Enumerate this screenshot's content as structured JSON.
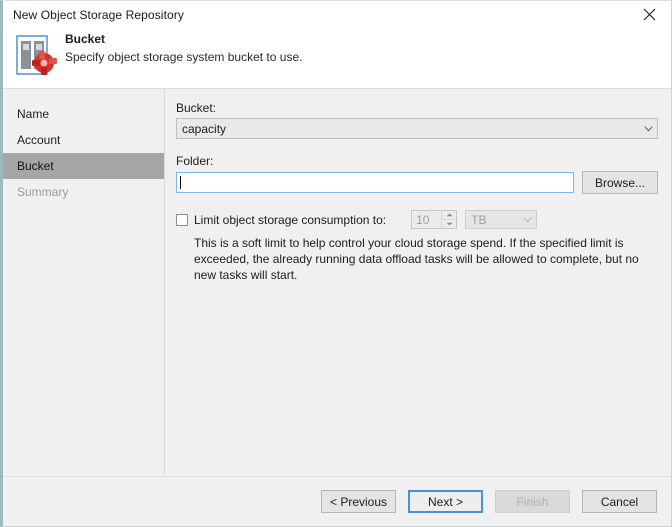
{
  "window": {
    "title": "New Object Storage Repository",
    "close_icon": "close-icon"
  },
  "header": {
    "title": "Bucket",
    "subtitle": "Specify object storage system bucket to use.",
    "icon": "object-storage-repository-icon"
  },
  "sidebar": {
    "items": [
      {
        "label": "Name",
        "state": "normal"
      },
      {
        "label": "Account",
        "state": "normal"
      },
      {
        "label": "Bucket",
        "state": "selected"
      },
      {
        "label": "Summary",
        "state": "disabled"
      }
    ]
  },
  "main": {
    "bucket": {
      "label": "Bucket:",
      "value": "capacity",
      "arrow_icon": "chevron-down-icon"
    },
    "folder": {
      "label": "Folder:",
      "value": "",
      "browse_label": "Browse..."
    },
    "limit": {
      "checkbox_label": "Limit object storage consumption to:",
      "checked": false,
      "amount": "10",
      "unit": "TB",
      "unit_arrow_icon": "chevron-down-icon",
      "spinner_up_icon": "spinner-up-icon",
      "spinner_down_icon": "spinner-down-icon",
      "hint": "This is a soft limit to help control your cloud storage spend. If the specified limit is exceeded, the already running data offload tasks will be allowed to complete, but no new tasks will start."
    }
  },
  "footer": {
    "previous_label": "< Previous",
    "next_label": "Next >",
    "finish_label": "Finish",
    "cancel_label": "Cancel"
  },
  "colors": {
    "accent_focus": "#7eb4ea",
    "default_button_border": "#4a90d9",
    "selected_nav_bg": "#a6a6a6",
    "window_bg": "#f0f0f0",
    "icon_red": "#d9302c"
  }
}
